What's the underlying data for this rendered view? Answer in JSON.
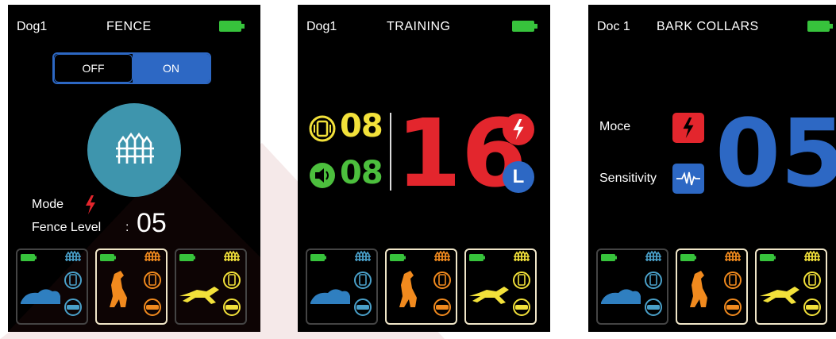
{
  "colors": {
    "accent_blue": "#2d68c4",
    "teal": "#3e95ad",
    "red": "#e3262d",
    "yellow": "#f2e13a",
    "green": "#4cbf3d",
    "orange": "#f18a1e",
    "battery_green": "#37c33c"
  },
  "screens": [
    {
      "dog_label": "Dog1",
      "title": "FENCE",
      "toggle": {
        "off_label": "OFF",
        "on_label": "ON",
        "selected": "ON"
      },
      "mode_label": "Mode",
      "fence_level_label": "Fence Level",
      "fence_level_colon": ":",
      "fence_level_value": "05",
      "icons": [
        "battery-icon",
        "fence-icon",
        "shock-icon"
      ]
    },
    {
      "dog_label": "Dog1",
      "title": "TRAINING",
      "vibration_value": "08",
      "tone_value": "08",
      "main_value": "16",
      "badge_l": "L",
      "icons": [
        "vibration-icon",
        "speaker-icon",
        "shock-icon"
      ]
    },
    {
      "dog_label": "Doc 1",
      "title": "BARK COLLARS",
      "mode_label": "Moce",
      "sensitivity_label": "Sensitivity",
      "main_value": "05",
      "icons": [
        "shock-icon",
        "waveform-icon"
      ]
    }
  ],
  "dog_cards": [
    {
      "name": "dog-card-lying",
      "dog_color": "#2f7fc0",
      "fence_color": "#4aa0c9",
      "selected": false
    },
    {
      "name": "dog-card-sitting",
      "dog_color": "#f18a1e",
      "fence_color": "#f18a1e",
      "selected": true
    },
    {
      "name": "dog-card-running",
      "dog_color": "#f2e13a",
      "fence_color": "#f2e13a",
      "selected": false
    }
  ]
}
